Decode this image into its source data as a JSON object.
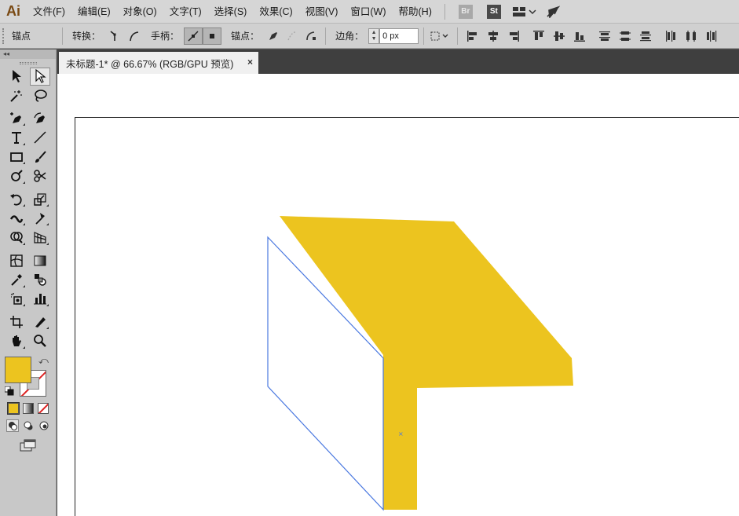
{
  "app": {
    "logo": "Ai"
  },
  "menu": {
    "items": [
      "文件(F)",
      "编辑(E)",
      "对象(O)",
      "文字(T)",
      "选择(S)",
      "效果(C)",
      "视图(V)",
      "窗口(W)",
      "帮助(H)"
    ],
    "badges": {
      "bridge": "Br",
      "stock": "St"
    }
  },
  "controlbar": {
    "panel_label": "锚点",
    "convert_label": "转换：",
    "handles_label": "手柄：",
    "anchors_label": "锚点：",
    "corner_label": "边角：",
    "corner_value": "0 px"
  },
  "document": {
    "tab_title": "未标题-1* @ 66.67% (RGB/GPU 预览)",
    "close_glyph": "×"
  },
  "colors": {
    "fill": "#ecc41f",
    "stroke": "none",
    "selection_path": "#4a78e0",
    "panel": "#c8c8c8",
    "menubar": "#d6d6d6"
  },
  "icons": {
    "toolbar": [
      [
        "selection-tool-icon",
        "direct-selection-tool-icon"
      ],
      [
        "magic-wand-tool-icon",
        "lasso-tool-icon"
      ],
      [
        "pen-tool-icon",
        "curvature-tool-icon"
      ],
      [
        "type-tool-icon",
        "line-segment-tool-icon"
      ],
      [
        "rectangle-tool-icon",
        "paintbrush-tool-icon"
      ],
      [
        "shaper-tool-icon",
        "scissors-tool-icon"
      ],
      [
        "rotate-tool-icon",
        "scale-tool-icon"
      ],
      [
        "width-tool-icon",
        "puppet-warp-tool-icon"
      ],
      [
        "shape-builder-tool-icon",
        "perspective-grid-tool-icon"
      ],
      [
        "mesh-tool-icon",
        "gradient-tool-icon"
      ],
      [
        "eyedropper-tool-icon",
        "blend-tool-icon"
      ],
      [
        "symbol-sprayer-tool-icon",
        "column-graph-tool-icon"
      ],
      [
        "artboard-tool-icon",
        "slice-tool-icon"
      ],
      [
        "hand-tool-icon",
        "zoom-tool-icon"
      ]
    ]
  }
}
